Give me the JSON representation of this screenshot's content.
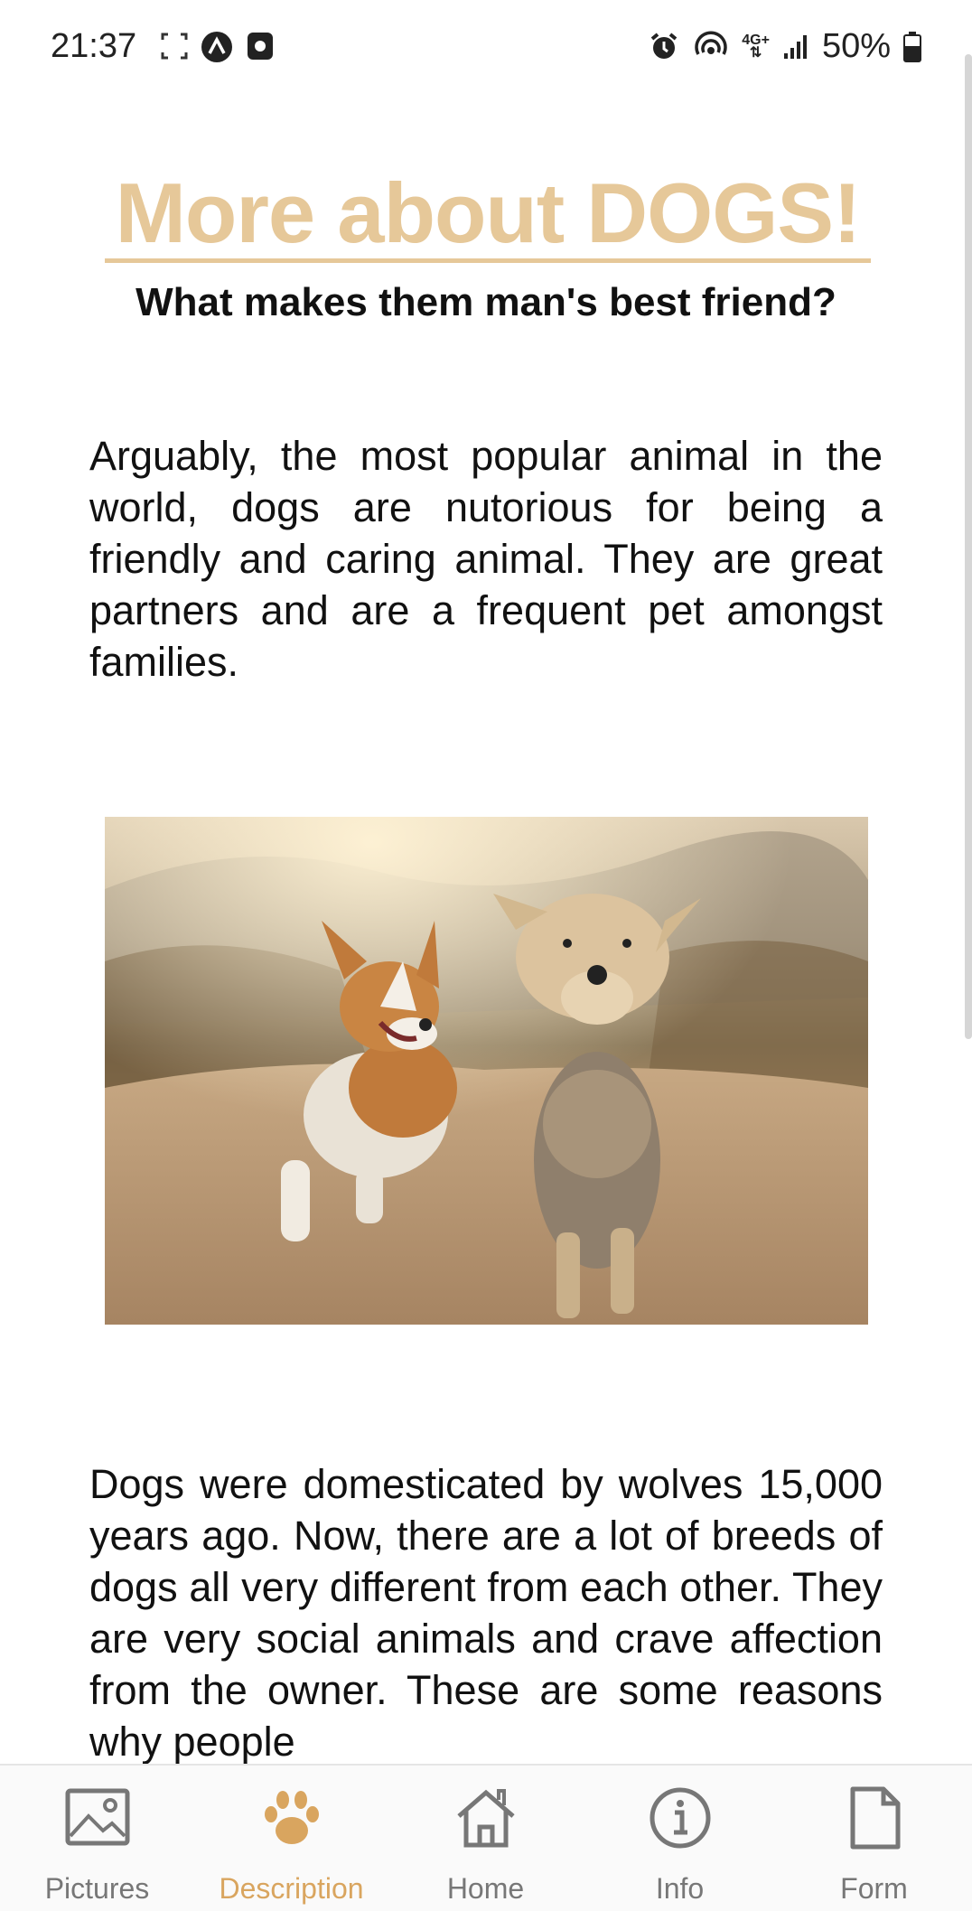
{
  "status_bar": {
    "time": "21:37",
    "network": "4G+",
    "battery": "50%"
  },
  "header": {
    "title": "More about DOGS!",
    "subtitle": "What makes them man's best friend?"
  },
  "content": {
    "paragraph_1": "Arguably, the most popular animal in the world, dogs are nutorious for being a friendly and caring animal. They are great partners and are a frequent pet amongst families.",
    "paragraph_2": "Dogs were domesticated by wolves 15,000 years ago. Now, there are a lot of breeds of dogs all very different from each other. They are very social animals and crave affection from the owner. These are some reasons why people"
  },
  "bottom_nav": {
    "items": [
      {
        "label": "Pictures",
        "icon": "image-icon",
        "active": false
      },
      {
        "label": "Description",
        "icon": "paw-icon",
        "active": true
      },
      {
        "label": "Home",
        "icon": "home-icon",
        "active": false
      },
      {
        "label": "Info",
        "icon": "info-icon",
        "active": false
      },
      {
        "label": "Form",
        "icon": "document-icon",
        "active": false
      }
    ]
  },
  "colors": {
    "accent": "#e6c899",
    "active_nav": "#d9a55f",
    "inactive_nav": "#777777"
  }
}
